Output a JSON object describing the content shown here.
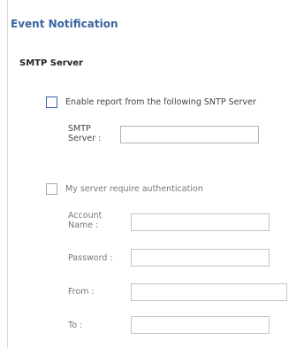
{
  "page": {
    "title": "Event Notification",
    "section": "SMTP Server"
  },
  "smtp": {
    "enable_label": "Enable report from the following SNTP Server",
    "server_label_1": "SMTP",
    "server_label_2": "Server :",
    "server_value": ""
  },
  "auth": {
    "require_label": "My server require authentication",
    "account_label_1": "Account",
    "account_label_2": "Name :",
    "account_value": "",
    "password_label": "Password :",
    "password_value": "",
    "from_label": "From :",
    "from_value": "",
    "to_label": "To :",
    "to_value": ""
  },
  "colors": {
    "title": "#3a63a0",
    "checkbox_active": "#3a5fa6"
  }
}
